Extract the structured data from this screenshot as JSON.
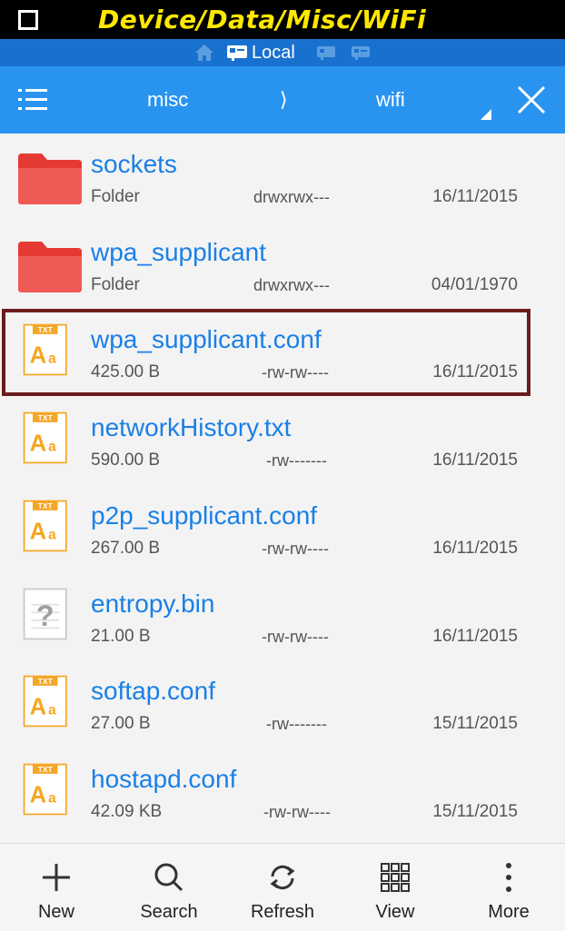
{
  "title_strip": {
    "text": "Device/Data/Misc/WiFi"
  },
  "location_bar": {
    "local_label": "Local"
  },
  "path_bar": {
    "segments": [
      "misc",
      "wifi"
    ],
    "separator": "⟩"
  },
  "files": [
    {
      "name": "sockets",
      "type": "Folder",
      "perm": "drwxrwx---",
      "date": "16/11/2015",
      "icon": "folder-icon"
    },
    {
      "name": "wpa_supplicant",
      "type": "Folder",
      "perm": "drwxrwx---",
      "date": "04/01/1970",
      "icon": "folder-icon"
    },
    {
      "name": "wpa_supplicant.conf",
      "type": "425.00 B",
      "perm": "-rw-rw----",
      "date": "16/11/2015",
      "icon": "txt-file-icon",
      "highlighted": true
    },
    {
      "name": "networkHistory.txt",
      "type": "590.00 B",
      "perm": "-rw-------",
      "date": "16/11/2015",
      "icon": "txt-file-icon"
    },
    {
      "name": "p2p_supplicant.conf",
      "type": "267.00 B",
      "perm": "-rw-rw----",
      "date": "16/11/2015",
      "icon": "txt-file-icon"
    },
    {
      "name": "entropy.bin",
      "type": "21.00 B",
      "perm": "-rw-rw----",
      "date": "16/11/2015",
      "icon": "unknown-file-icon"
    },
    {
      "name": "softap.conf",
      "type": "27.00 B",
      "perm": "-rw-------",
      "date": "15/11/2015",
      "icon": "txt-file-icon"
    },
    {
      "name": "hostapd.conf",
      "type": "42.09 KB",
      "perm": "-rw-rw----",
      "date": "15/11/2015",
      "icon": "txt-file-icon"
    }
  ],
  "icon_text": {
    "txt_badge": "TXT",
    "txt_glyph": "A",
    "txt_glyph_small": "a",
    "unknown_glyph": "?"
  },
  "toolbar": {
    "new_label": "New",
    "search_label": "Search",
    "refresh_label": "Refresh",
    "view_label": "View",
    "more_label": "More"
  },
  "colors": {
    "title_bg": "#000000",
    "title_text": "#ffe800",
    "location_bar": "#1971cf",
    "path_bar": "#2994f0",
    "file_name": "#1a80e6",
    "folder": "#e53935",
    "txt_icon": "#f5a623",
    "highlight_border": "#6b1b1b"
  }
}
